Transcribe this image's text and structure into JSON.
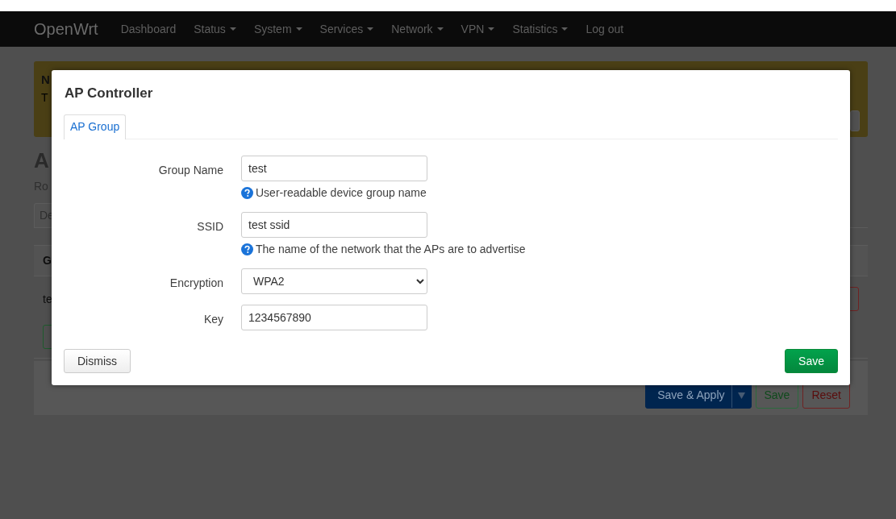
{
  "navbar": {
    "brand": "OpenWrt",
    "items": [
      {
        "label": "Dashboard",
        "dropdown": false
      },
      {
        "label": "Status",
        "dropdown": true
      },
      {
        "label": "System",
        "dropdown": true
      },
      {
        "label": "Services",
        "dropdown": true
      },
      {
        "label": "Network",
        "dropdown": true
      },
      {
        "label": "VPN",
        "dropdown": true
      },
      {
        "label": "Statistics",
        "dropdown": true
      },
      {
        "label": "Log out",
        "dropdown": false
      }
    ]
  },
  "background": {
    "notice_title": "N",
    "notice_text": "T",
    "heading": "A",
    "subtitle": "Ro",
    "tab": "De",
    "table_header": "G",
    "table_cell": "te",
    "actions": [
      {
        "label": "Save & Apply",
        "kind": "split"
      },
      {
        "label": "Save",
        "kind": "save"
      },
      {
        "label": "Reset",
        "kind": "reset"
      }
    ]
  },
  "modal": {
    "title": "AP Controller",
    "tabs": [
      {
        "label": "AP Group",
        "selected": true
      }
    ],
    "fields": [
      {
        "label": "Group Name",
        "kind": "text",
        "value": "test",
        "help": "User-readable device group name"
      },
      {
        "label": "SSID",
        "kind": "text",
        "value": "test ssid",
        "help": "The name of the network that the APs are to advertise"
      },
      {
        "label": "Encryption",
        "kind": "select",
        "value": "WPA2"
      },
      {
        "label": "Key",
        "kind": "text",
        "value": "1234567890"
      }
    ],
    "buttons": [
      {
        "label": "Dismiss",
        "kind": "secondary"
      },
      {
        "label": "Save",
        "kind": "primary"
      }
    ]
  }
}
